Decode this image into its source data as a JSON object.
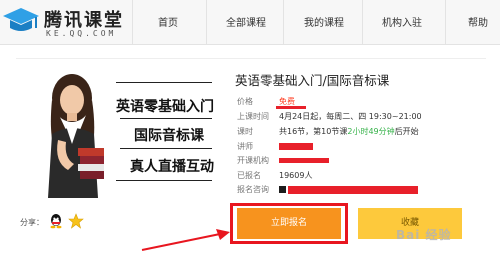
{
  "header": {
    "logo_title": "腾讯课堂",
    "logo_sub": "KE.QQ.COM",
    "nav": [
      "首页",
      "全部课程",
      "我的课程",
      "机构入驻",
      "帮助"
    ]
  },
  "cover": {
    "lines": [
      "英语零基础入门",
      "国际音标课",
      "真人直播互动"
    ]
  },
  "course": {
    "title": "英语零基础入门/国际音标课",
    "price_label": "价格",
    "price_value": "免费",
    "time_label": "上课时间",
    "time_value": "4月24日起，每周二、四 19:30~21:00",
    "hours_label": "课时",
    "hours_prefix": "共16节，第10节课",
    "hours_countdown": "2小时49分钟",
    "hours_suffix": "后开始",
    "teacher_label": "讲师",
    "org_label": "开课机构",
    "enrolled_label": "已报名",
    "enrolled_value": "19609人",
    "consult_label": "报名咨询"
  },
  "share": {
    "label": "分享："
  },
  "buttons": {
    "enroll": "立即报名",
    "favorite": "收藏"
  },
  "watermark": "Bai 经验",
  "colors": {
    "accent_orange": "#f7931e",
    "favorite_yellow": "#fdc93c",
    "free_red": "#ff3b1f",
    "countdown_green": "#36b24a",
    "annotation_red": "#e8161f"
  }
}
